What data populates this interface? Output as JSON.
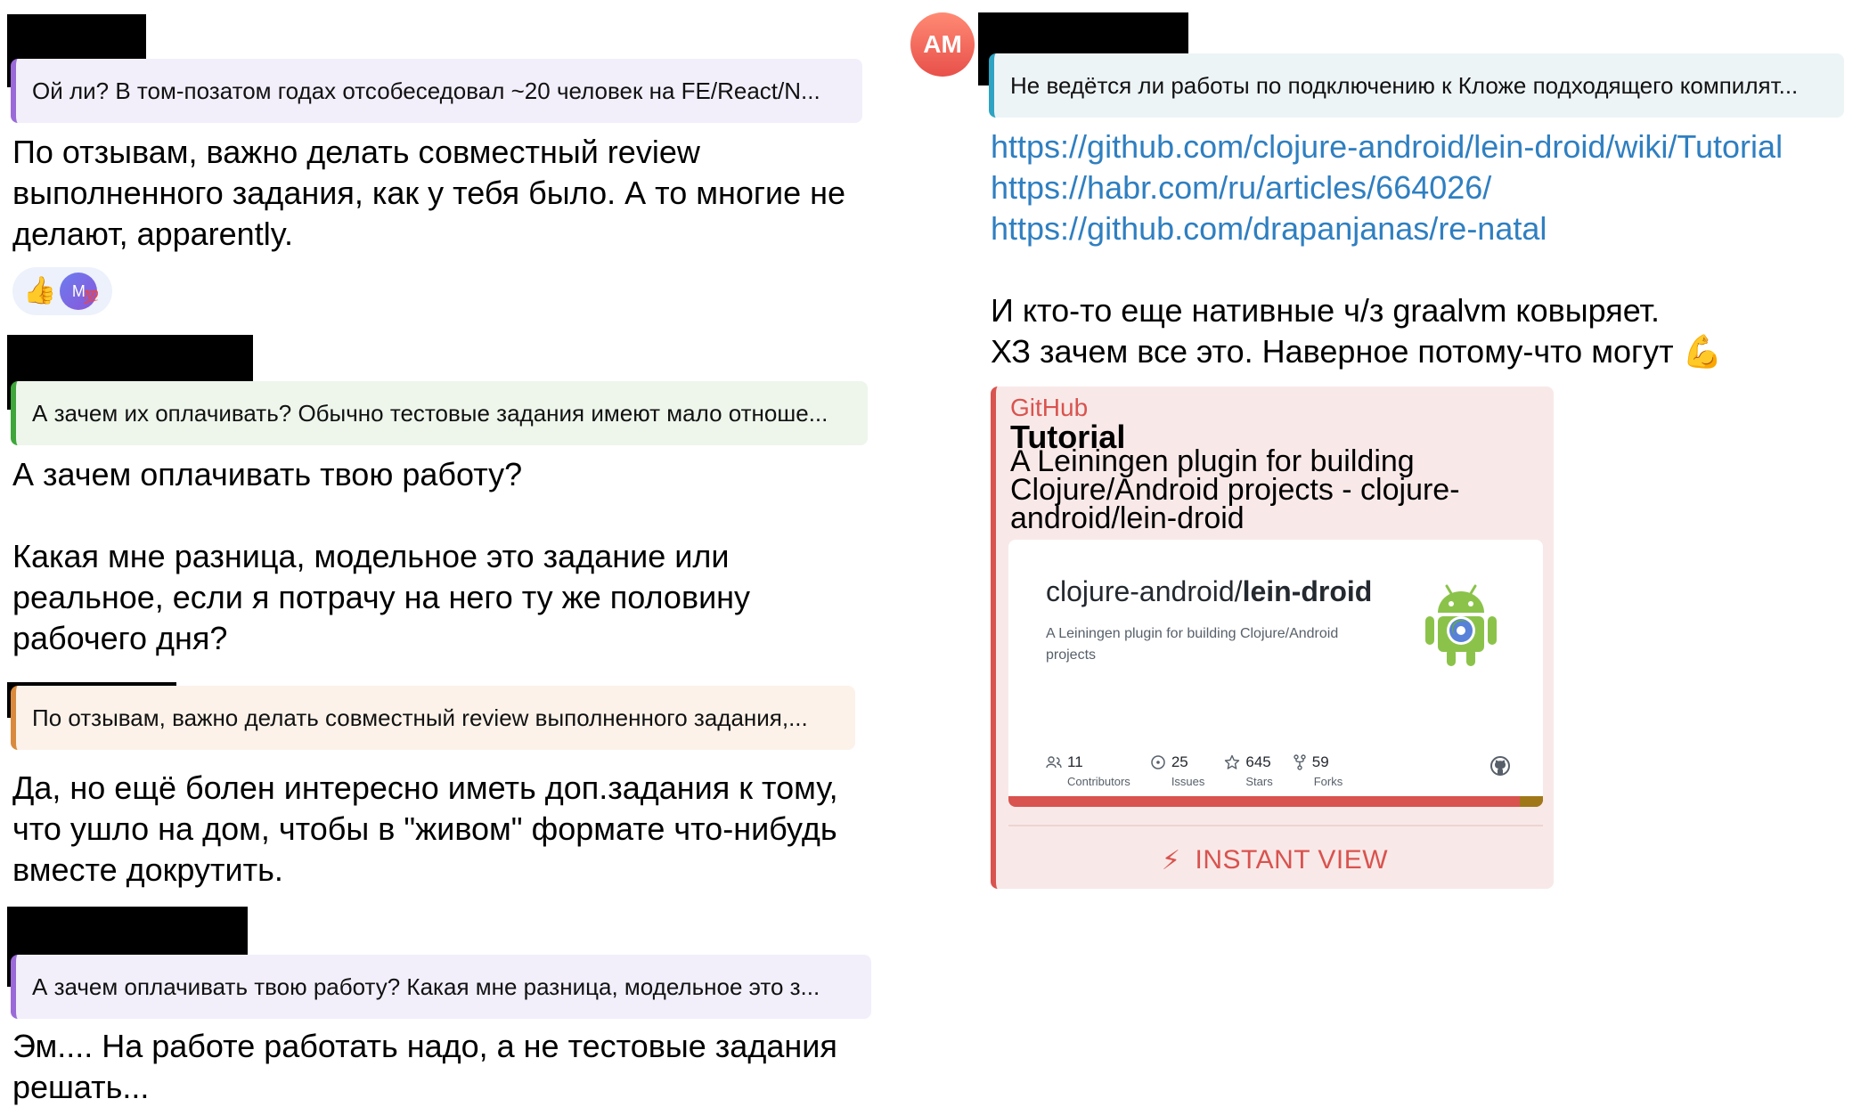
{
  "left_column": {
    "messages": [
      {
        "reply_text": "Ой ли? В том-позатом годах отсобеседовал ~20 человек на FE/React/N...",
        "lines": [
          "По отзывам, важно делать совместный review",
          "выполненного задания, как у тебя было. А то многие не",
          "делают, apparently."
        ],
        "reactions": {
          "thumb": "👍",
          "avatar_initial": "M",
          "hundred": "💯"
        }
      },
      {
        "reply_text": "А зачем их оплачивать? Обычно тестовые задания имеют мало отноше...",
        "lines": [
          "А зачем оплачивать твою работу?",
          "",
          "Какая мне разница, модельное это задание или",
          "реальное, если я потрачу на него ту же половину",
          "рабочего дня?"
        ]
      },
      {
        "reply_text": "По отзывам, важно делать совместный review выполненного задания,...",
        "lines": [
          "Да, но ещё болен интересно иметь доп.задания к тому,",
          "что ушло на дом, чтобы в \"живом\" формате что-нибудь",
          "вместе докрутить."
        ]
      },
      {
        "reply_text": "А зачем оплачивать твою работу?  Какая мне разница, модельное это з...",
        "lines": [
          "Эм.... На работе работать надо, а не тестовые задания",
          "решать..."
        ]
      }
    ]
  },
  "right_column": {
    "avatar_initials": "AM",
    "reply_text": "Не ведётся ли работы по подключению к Кложе подходящего компилят...",
    "links": [
      "https://github.com/clojure-android/lein-droid/wiki/Tutorial",
      "https://habr.com/ru/articles/664026/",
      "https://github.com/drapanjanas/re-natal"
    ],
    "text_lines": [
      "И кто-то еще нативные ч/з graalvm ковыряет.",
      "ХЗ зачем все это. Наверное потому-что могут 💪"
    ],
    "preview": {
      "site": "GitHub",
      "title": "Tutorial",
      "description_lines": [
        "A Leiningen plugin for building",
        "Clojure/Android projects - clojure-",
        "android/lein-droid"
      ],
      "card": {
        "owner": "clojure-android/",
        "repo": "lein-droid",
        "description": "A Leiningen plugin for building Clojure/Android projects",
        "stats": [
          {
            "value": "11",
            "label": "Contributors",
            "icon": "contributors-icon"
          },
          {
            "value": "25",
            "label": "Issues",
            "icon": "issues-icon"
          },
          {
            "value": "645",
            "label": "Stars",
            "icon": "star-icon"
          },
          {
            "value": "59",
            "label": "Forks",
            "icon": "fork-icon"
          }
        ]
      },
      "instant_view_label": "INSTANT VIEW",
      "instant_view_icon": "⚡"
    }
  },
  "colors": {
    "link": "#2f7fc1",
    "github_red": "#d9534f",
    "reply_purple": "#9b6ad9",
    "reply_green": "#3ea63a",
    "reply_orange": "#d98a3c",
    "reply_teal": "#2ea3c2"
  }
}
